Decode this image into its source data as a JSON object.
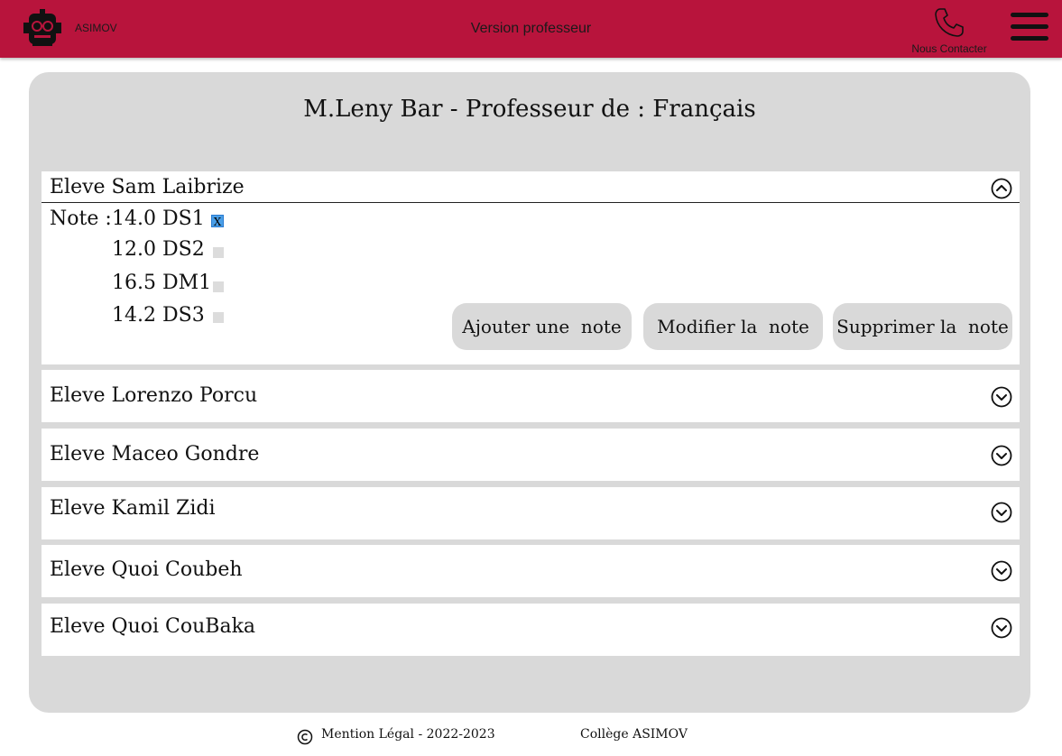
{
  "header": {
    "brand": "ASIMOV",
    "version": "Version professeur",
    "contact_label": "Nous Contacter",
    "background_color": "#b8143c",
    "icons": [
      "robot-logo-icon",
      "phone-icon",
      "hamburger-menu-icon"
    ]
  },
  "teacher_title": "M.Leny Bar - Professeur de : Français",
  "students": [
    {
      "name": "Eleve Sam Laibrize",
      "expanded": true
    },
    {
      "name": "Eleve Lorenzo Porcu",
      "expanded": false
    },
    {
      "name": "Eleve Maceo Gondre",
      "expanded": false
    },
    {
      "name": "Eleve Kamil Zidi",
      "expanded": false
    },
    {
      "name": "Eleve Quoi Coubeh",
      "expanded": false
    },
    {
      "name": "Eleve Quoi CouBaka",
      "expanded": false
    }
  ],
  "notes": {
    "label": "Note :",
    "grades": [
      {
        "text": "14.0 DS1",
        "checked": true,
        "mark": "X"
      },
      {
        "text": "12.0 DS2",
        "checked": false
      },
      {
        "text": "16.5 DM1",
        "checked": false
      },
      {
        "text": "14.2 DS3",
        "checked": false
      }
    ]
  },
  "buttons": {
    "add": "Ajouter une  note",
    "edit": "Modifier la  note",
    "delete": "Supprimer la  note"
  },
  "footer": {
    "legal": "Mention Légal - 2022-2023",
    "school": "Collège ASIMOV"
  }
}
